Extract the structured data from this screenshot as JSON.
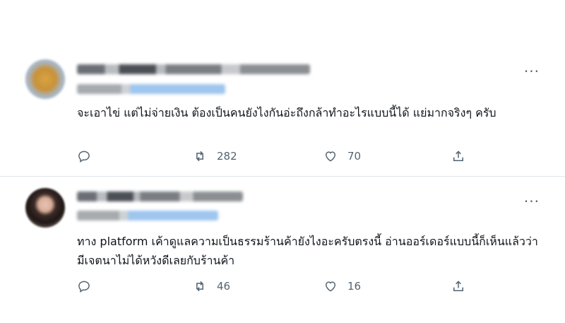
{
  "tweets": [
    {
      "text": "จะเอาไข่ แต่ไม่จ่ายเงิน ต้องเป็นคนยังไงกันอ่ะถึงกล้าทำอะไรแบบนี้ได้ แย่มากจริงๆ ครับ",
      "replies": "",
      "retweets": "282",
      "likes": "70",
      "more_label": "···"
    },
    {
      "text": "ทาง platform เค้าดูแลความเป็นธรรมร้านค้ายังไงอะครับตรงนี้  อ่านออร์เดอร์แบบนี้ก็เห็นแล้วว่ามีเจตนาไม่ได้หวังดีเลยกับร้านค้า",
      "replies": "",
      "retweets": "46",
      "likes": "16",
      "more_label": "···"
    }
  ],
  "icons": [
    "reply-icon",
    "retweet-icon",
    "like-icon",
    "share-icon",
    "more-icon"
  ],
  "colors": {
    "text": "#0f1419",
    "secondary": "#536471",
    "divider": "#e1e6ea"
  }
}
